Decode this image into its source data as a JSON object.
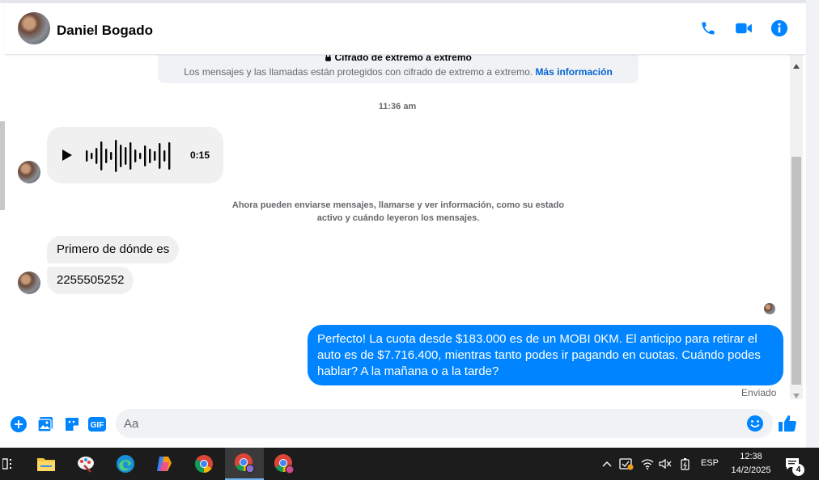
{
  "header": {
    "contact_name": "Daniel Bogado"
  },
  "messages": {
    "e2e_title": "Cifrado de extremo a extremo",
    "e2e_text": "Los mensajes y las llamadas están protegidos con cifrado de extremo a extremo.",
    "e2e_link": "Más información",
    "timestamp": "11:36 am",
    "audio_duration": "0:15",
    "info_text": "Ahora pueden enviarse mensajes, llamarse y ver información, como su estado activo y cuándo leyeron los mensajes.",
    "incoming": [
      {
        "text": "Primero de dónde es"
      },
      {
        "text": "2255505252"
      }
    ],
    "outgoing": {
      "text": "Perfecto! La cuota desde $183.000 es de un MOBI 0KM. El anticipo para retirar el auto es de $7.716.400, mientras tanto podes ir pagando en cuotas. Cuándo podes hablar? A la mañana o a la tarde?"
    },
    "sent_status": "Enviado"
  },
  "composer": {
    "placeholder": "Aa"
  },
  "taskbar": {
    "language": "ESP",
    "time": "12:38",
    "date": "14/2/2025",
    "notification_count": "4"
  },
  "colors": {
    "accent": "#0084ff",
    "bubble_incoming": "#f0f0f0",
    "taskbar": "#1c1c1c"
  }
}
